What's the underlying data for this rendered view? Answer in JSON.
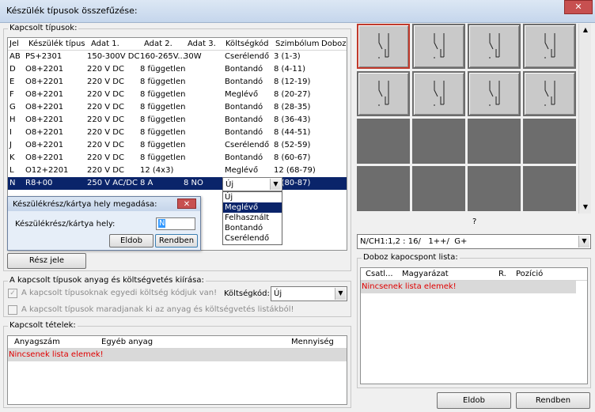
{
  "window": {
    "title": "Készülék típusok összefűzése:",
    "close": "✕"
  },
  "types_group": {
    "label": "Kapcsolt típusok:",
    "columns": [
      "Jel",
      "Készülék típus",
      "Adat 1.",
      "Adat 2.",
      "Adat 3.",
      "Költségkód",
      "Szimbólum",
      "Doboz"
    ],
    "rows": [
      [
        "AB",
        "PS+2301",
        "150-300V DC",
        "160-265V...",
        "30W",
        "Cserélendő",
        "3 (1-3)",
        ""
      ],
      [
        "D",
        "O8+2201",
        "220 V DC",
        "8 független",
        "",
        "Bontandó",
        "8 (4-11)",
        ""
      ],
      [
        "E",
        "O8+2201",
        "220 V DC",
        "8 független",
        "",
        "Bontandó",
        "8 (12-19)",
        ""
      ],
      [
        "F",
        "O8+2201",
        "220 V DC",
        "8 független",
        "",
        "Meglévő",
        "8 (20-27)",
        ""
      ],
      [
        "G",
        "O8+2201",
        "220 V DC",
        "8 független",
        "",
        "Bontandó",
        "8 (28-35)",
        ""
      ],
      [
        "H",
        "O8+2201",
        "220 V DC",
        "8 független",
        "",
        "Bontandó",
        "8 (36-43)",
        ""
      ],
      [
        "I",
        "O8+2201",
        "220 V DC",
        "8 független",
        "",
        "Bontandó",
        "8 (44-51)",
        ""
      ],
      [
        "J",
        "O8+2201",
        "220 V DC",
        "8 független",
        "",
        "Cserélendő",
        "8 (52-59)",
        ""
      ],
      [
        "K",
        "O8+2201",
        "220 V DC",
        "8 független",
        "",
        "Bontandó",
        "8 (60-67)",
        ""
      ],
      [
        "L",
        "O12+2201",
        "220 V DC",
        "12 (4x3)",
        "",
        "Meglévő",
        "12 (68-79)",
        ""
      ],
      [
        "N",
        "R8+00",
        "250 V AC/DC",
        "8 A",
        "8 NO",
        "",
        "8 (80-87)",
        ""
      ]
    ],
    "selected_row": 10,
    "cost_combo_value": "Új",
    "cost_options": [
      "Új",
      "Meglévő",
      "Felhasznált",
      "Bontandó",
      "Cserélendő"
    ],
    "highlighted_option": 1,
    "part_button": "Rész jele"
  },
  "subdialog": {
    "title": "Készülékrész/kártya hely megadása:",
    "close": "✕",
    "field_label": "Készülékrész/kártya hely:",
    "field_value": "N",
    "discard": "Eldob",
    "ok": "Rendben"
  },
  "material_group": {
    "label": "A kapcsolt típusok anyag és költségvetés kiírása:",
    "check1": "A kapcsolt típusoknak egyedi költség kódjuk van!",
    "check1_checked": true,
    "cost_label": "Költségkód:",
    "cost_value": "Új",
    "check2": "A kapcsolt típusok maradjanak ki az anyag és költségvetés listákból!",
    "check2_checked": false
  },
  "items_group": {
    "label": "Kapcsolt tételek:",
    "columns": [
      "Anyagszám",
      "Egyéb anyag",
      "Mennyiség"
    ],
    "empty": "Nincsenek lista elemek!"
  },
  "symbol_grid": {
    "tiles": [
      "light",
      "light",
      "light",
      "light",
      "light",
      "light",
      "light",
      "light",
      "dark",
      "dark",
      "dark",
      "dark",
      "dark",
      "dark",
      "dark",
      "dark"
    ],
    "active_tile": 0,
    "question": "?",
    "scroll_up": "▲",
    "scroll_down": "▼"
  },
  "channel_combo": {
    "value": "N/CH1:1,2 : 16/   1++/  G+"
  },
  "box_group": {
    "label": "Doboz kapocspont lista:",
    "columns": [
      "Csatl...",
      "Magyarázat",
      "R.",
      "Pozíció"
    ],
    "empty": "Nincsenek lista elemek!"
  },
  "footer": {
    "discard": "Eldob",
    "ok": "Rendben"
  },
  "colors": {
    "selection": "#0a246a",
    "empty_text": "#e00000",
    "active_tile_border": "#c0392b"
  }
}
